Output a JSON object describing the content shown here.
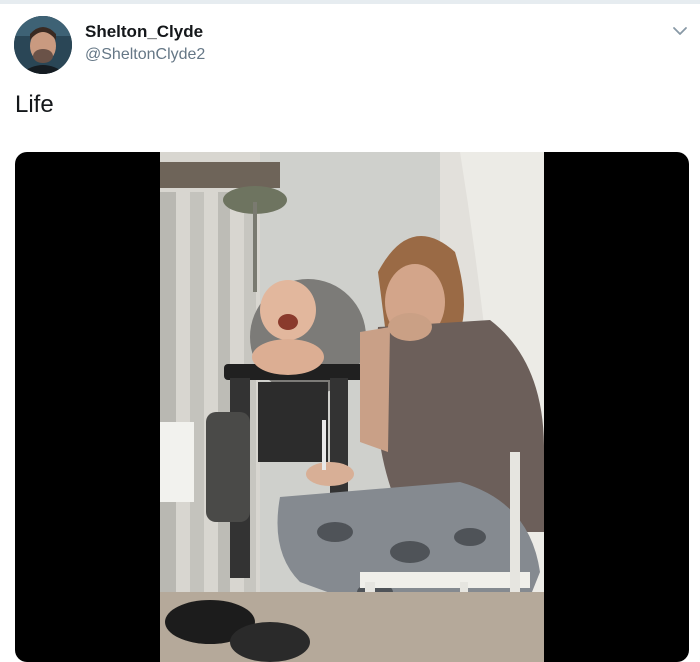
{
  "tweet": {
    "author": {
      "display_name": "Shelton_Clyde",
      "handle": "@SheltonClyde2",
      "avatar": "profile-photo"
    },
    "text": "Life",
    "menu_icon": "chevron-down-icon",
    "media": {
      "type": "video",
      "subject": "woman-in-grey-shirt-crying-beside-laughing-baby-in-high-chair"
    }
  },
  "colors": {
    "text_primary": "#14171a",
    "text_secondary": "#657786",
    "media_background": "#000000",
    "divider": "#e6ecf0"
  }
}
